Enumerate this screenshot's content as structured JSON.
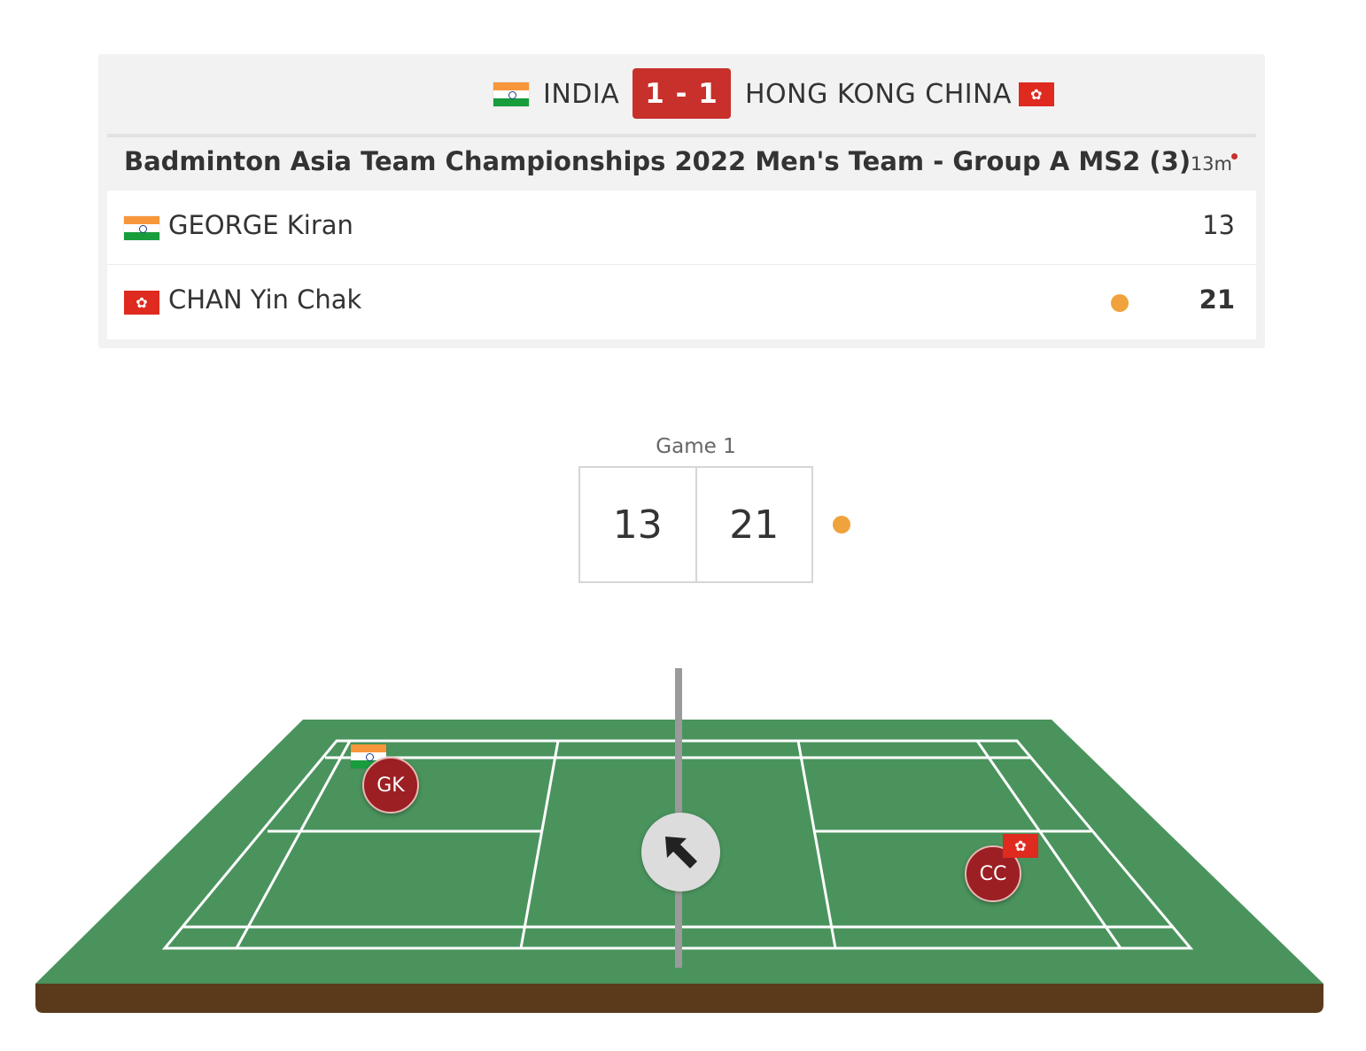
{
  "header": {
    "team_left": {
      "name": "INDIA",
      "flag": "india-flag"
    },
    "team_right": {
      "name": "HONG KONG CHINA",
      "flag": "hong-kong-flag"
    },
    "tie_score": "1 - 1",
    "accent_color": "#c8302c"
  },
  "event": {
    "title": "Badminton Asia Team Championships 2022 Men's Team - Group A MS2 (3)",
    "elapsed": "13m"
  },
  "players": [
    {
      "name": "GEORGE Kiran",
      "flag": "india-flag",
      "score": "13",
      "serving": false,
      "winner": false
    },
    {
      "name": "CHAN Yin Chak",
      "flag": "hong-kong-flag",
      "score": "21",
      "serving": true,
      "winner": true
    }
  ],
  "game": {
    "label": "Game 1",
    "score_left": "13",
    "score_right": "21",
    "serve_indicator_color": "#f0a23c"
  },
  "court": {
    "player_left": {
      "initials": "GK",
      "flag": "india-flag"
    },
    "player_right": {
      "initials": "CC",
      "flag": "hong-kong-flag"
    },
    "shuttle_control_icon": "arrow-up-left-icon",
    "surface_color": "#4a935d",
    "base_color": "#5b3a1c"
  }
}
